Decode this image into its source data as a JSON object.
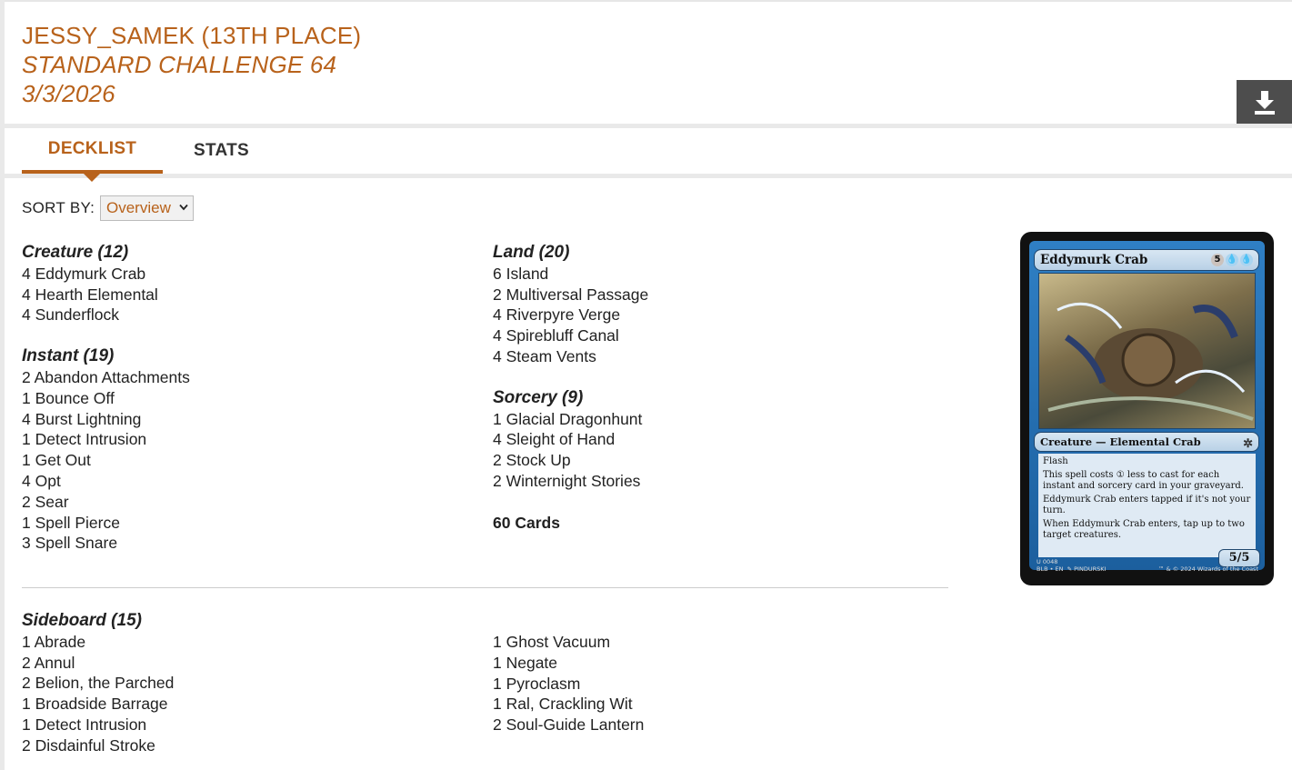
{
  "header": {
    "player": "JESSY_SAMEK (13TH PLACE)",
    "event": "STANDARD CHALLENGE 64",
    "date": "3/3/2026",
    "download_icon": "download-icon"
  },
  "tabs": [
    {
      "label": "DECKLIST",
      "active": true
    },
    {
      "label": "STATS",
      "active": false
    }
  ],
  "sort": {
    "label": "SORT BY:",
    "selected": "Overview"
  },
  "colors": {
    "accent": "#b8621b",
    "dark_button": "#4d4d4d"
  },
  "main_left": [
    {
      "category": "Creature (12)",
      "cards": [
        "4 Eddymurk Crab",
        "4 Hearth Elemental",
        "4 Sunderflock"
      ]
    },
    {
      "category": "Instant (19)",
      "cards": [
        "2 Abandon Attachments",
        "1 Bounce Off",
        "4 Burst Lightning",
        "1 Detect Intrusion",
        "1 Get Out",
        "4 Opt",
        "2 Sear",
        "1 Spell Pierce",
        "3 Spell Snare"
      ]
    }
  ],
  "main_right": [
    {
      "category": "Land (20)",
      "cards": [
        "6 Island",
        "2 Multiversal Passage",
        "4 Riverpyre Verge",
        "4 Spirebluff Canal",
        "4 Steam Vents"
      ]
    },
    {
      "category": "Sorcery (9)",
      "cards": [
        "1 Glacial Dragonhunt",
        "4 Sleight of Hand",
        "2 Stock Up",
        "2 Winternight Stories"
      ]
    }
  ],
  "total": "60 Cards",
  "sideboard": {
    "category": "Sideboard (15)",
    "left": [
      "1 Abrade",
      "2 Annul",
      "2 Belion, the Parched",
      "1 Broadside Barrage",
      "1 Detect Intrusion",
      "2 Disdainful Stroke"
    ],
    "right": [
      "1 Ghost Vacuum",
      "1 Negate",
      "1 Pyroclasm",
      "1 Ral, Crackling Wit",
      "2 Soul-Guide Lantern"
    ]
  },
  "card_preview": {
    "name": "Eddymurk Crab",
    "mana": [
      "5",
      "",
      ""
    ],
    "type_line": "Creature — Elemental Crab",
    "rules": [
      "Flash",
      "This spell costs ① less to cast for each instant and sorcery card in your graveyard.",
      "Eddymurk Crab enters tapped if it's not your turn.",
      "When Eddymurk Crab enters, tap up to two target creatures."
    ],
    "pt": "5/5",
    "collector": "U 0048",
    "set_line": "BLB • EN",
    "artist": "PINDURSKI",
    "copyright": "™ & © 2024 Wizards of the Coast"
  }
}
